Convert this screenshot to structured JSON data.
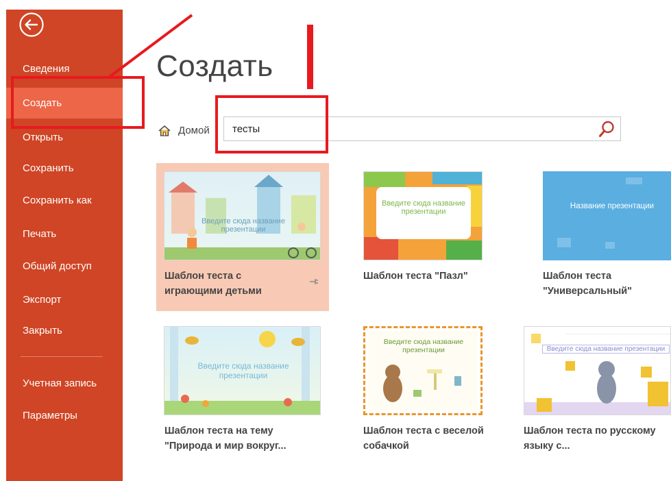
{
  "sidebar": {
    "items": [
      {
        "label": "Сведения"
      },
      {
        "label": "Создать"
      },
      {
        "label": "Открыть"
      },
      {
        "label": "Сохранить"
      },
      {
        "label": "Сохранить как"
      },
      {
        "label": "Печать"
      },
      {
        "label": "Общий доступ"
      },
      {
        "label": "Экспорт"
      },
      {
        "label": "Закрыть"
      },
      {
        "label": "Учетная запись"
      },
      {
        "label": "Параметры"
      }
    ],
    "active": "Создать"
  },
  "main": {
    "title": "Создать",
    "breadcrumb_home": "Домой",
    "search": {
      "value": "тесты"
    }
  },
  "templates": [
    {
      "caption": "Шаблон теста с играющими детьми",
      "thumb_text": "Введите сюда название презентации",
      "selected": true
    },
    {
      "caption": "Шаблон теста \"Пазл\"",
      "thumb_text": "Введите сюда название презентации"
    },
    {
      "caption": "Шаблон теста \"Универсальный\"",
      "thumb_text": "Название презентации"
    },
    {
      "caption": "Шаблон теста на тему \"Природа и мир вокруг...",
      "thumb_text": "Введите сюда название презентации"
    },
    {
      "caption": "Шаблон теста с веселой собачкой",
      "thumb_text": "Введите сюда название презентации"
    },
    {
      "caption": "Шаблон теста по русскому языку с...",
      "thumb_text": "Введите сюда название презентации"
    }
  ],
  "colors": {
    "sidebar": "#cf4525",
    "active_item": "#ec6647",
    "selected_tile": "#f8c9b4",
    "annotation": "#e8191f"
  },
  "icons": [
    "back-arrow-icon",
    "home-icon",
    "search-icon",
    "pin-icon"
  ]
}
